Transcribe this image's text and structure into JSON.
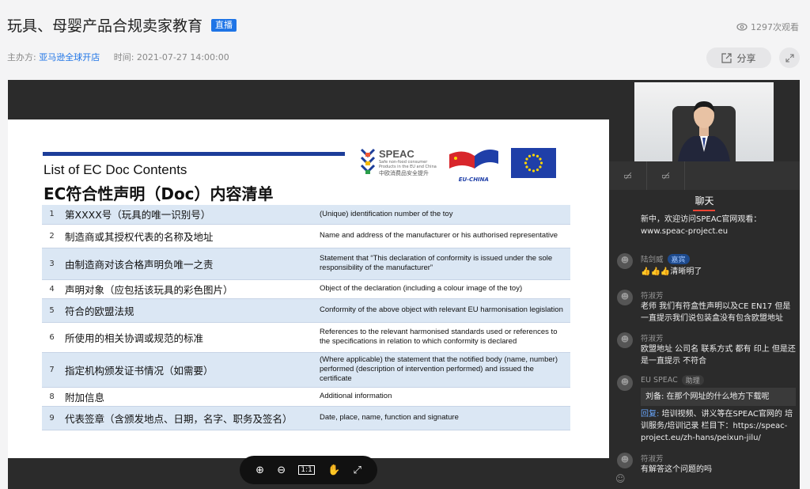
{
  "header": {
    "title": "玩具、母婴产品合规卖家教育",
    "live_badge": "直播",
    "views": "1297次观看",
    "host_label": "主办方:",
    "host_name": "亚马逊全球开店",
    "time_label": "时间:",
    "time_value": "2021-07-27 14:00:00",
    "share_label": "分享"
  },
  "slide": {
    "title_en": "List of EC Doc Contents",
    "title_cn": "EC符合性声明（Doc）内容清单",
    "speac_name": "SPEAC",
    "speac_sub1": "Safe non-food consumer",
    "speac_sub2": "Products in the EU and China",
    "speac_sub3": "中欧消费品安全提升",
    "euchina_label": "EU-CHINA",
    "rows": [
      {
        "n": "1",
        "cn": "第XXXX号（玩具的唯一识别号）",
        "en": "(Unique) identification number of the toy"
      },
      {
        "n": "2",
        "cn": "制造商或其授权代表的名称及地址",
        "en": "Name and address of the manufacturer or his authorised representative"
      },
      {
        "n": "3",
        "cn": "由制造商对该合格声明负唯一之责",
        "en": "Statement that “This declaration of conformity is issued under the sole responsibility of the manufacturer”"
      },
      {
        "n": "4",
        "cn": "声明对象（应包括该玩具的彩色图片）",
        "en": "Object of the declaration (including a colour image of the toy)"
      },
      {
        "n": "5",
        "cn": "符合的欧盟法规",
        "en": "Conformity of the above object with relevant EU harmonisation legislation"
      },
      {
        "n": "6",
        "cn": "所使用的相关协调或规范的标准",
        "en": "References to the relevant harmonised standards used or references to the specifications in relation to which conformity is declared"
      },
      {
        "n": "7",
        "cn": "指定机构颁发证书情况（如需要）",
        "en": "(Where applicable) the statement that the notified body (name, number) performed (description of intervention performed)  and issued the certificate"
      },
      {
        "n": "8",
        "cn": "附加信息",
        "en": "Additional information"
      },
      {
        "n": "9",
        "cn": "代表签章（含颁发地点、日期，名字、职务及签名）",
        "en": "Date, place, name, function and signature"
      }
    ]
  },
  "controls": {
    "zoom_in": "⊕",
    "zoom_out": "⊖",
    "actual_size": "1:1",
    "hand": "✋",
    "fullscreen": "⤢"
  },
  "chat": {
    "tab_label": "聊天",
    "messages": [
      {
        "name": "",
        "tag": "",
        "text": "新中，欢迎访问SPEAC官网观看：www.speac-project.eu"
      },
      {
        "name": "陆剑威",
        "tag": "嘉宾",
        "text": "👍👍👍清晰明了"
      },
      {
        "name": "符淑芳",
        "tag": "",
        "text": "老师 我们有符盒性声明以及CE EN17 但是一直提示我们说包装盒没有包含欧盟地址"
      },
      {
        "name": "符淑芳",
        "tag": "",
        "text": "欧盟地址 公司名 联系方式 都有 印上 但是还是一直提示 不符合"
      },
      {
        "name": "EU SPEAC",
        "tag": "助理",
        "quote": "刘备: 在那个网址的什么地方下载呢",
        "reply_label": "回复:",
        "text": " 培训视频、讲义等在SPEAC官网的 培训服务/培训记录 栏目下：https://speac-project.eu/zh-hans/peixun-jilu/"
      },
      {
        "name": "符淑芳",
        "tag": "",
        "text": "有解答这个问题的吗"
      }
    ]
  }
}
